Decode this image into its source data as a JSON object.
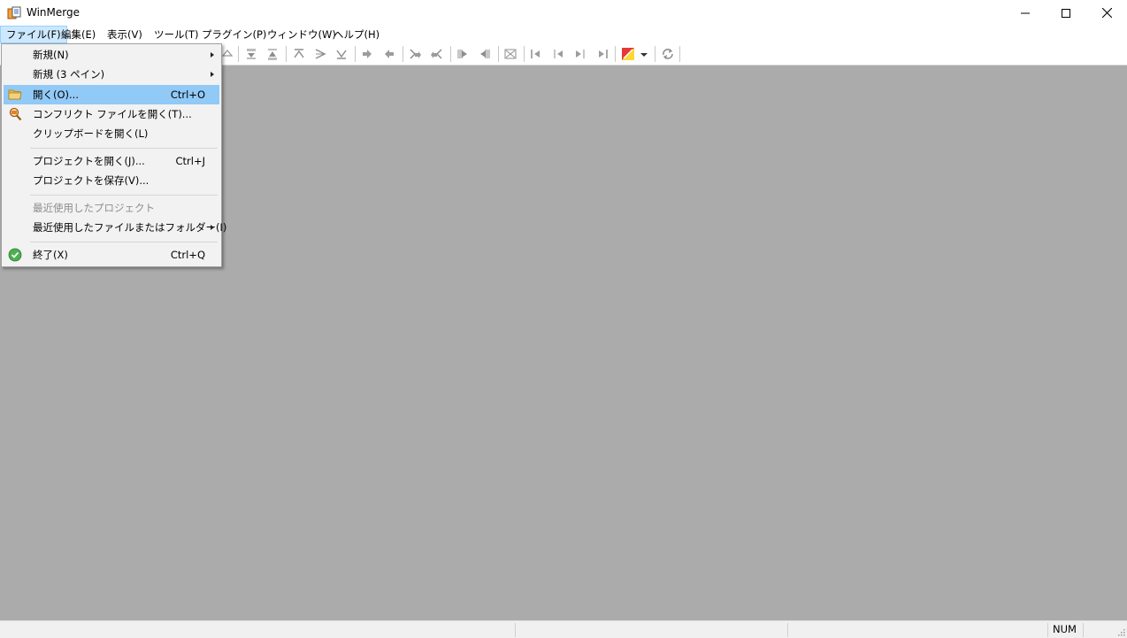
{
  "window": {
    "title": "WinMerge",
    "controls": {
      "minimize": "minimize",
      "maximize": "maximize",
      "close": "close"
    }
  },
  "menubar": {
    "items": [
      {
        "label": "ファイル(F)",
        "active": true
      },
      {
        "label": "編集(E)"
      },
      {
        "label": "表示(V)"
      },
      {
        "label": "ツール(T)"
      },
      {
        "label": "プラグイン(P)"
      },
      {
        "label": "ウィンドウ(W)"
      },
      {
        "label": "ヘルプ(H)"
      }
    ]
  },
  "file_menu": {
    "items": [
      {
        "label": "新規(N)",
        "submenu": true
      },
      {
        "label": "新規 (3 ペイン)",
        "submenu": true
      },
      {
        "label": "開く(O)...",
        "shortcut": "Ctrl+O",
        "icon": "folder-icon",
        "highlighted": true
      },
      {
        "label": "コンフリクト ファイルを開く(T)...",
        "icon": "conflict-search-icon"
      },
      {
        "label": "クリップボードを開く(L)"
      },
      {
        "label": "プロジェクトを開く(J)...",
        "shortcut": "Ctrl+J"
      },
      {
        "label": "プロジェクトを保存(V)..."
      },
      {
        "label": "最近使用したプロジェクト",
        "disabled": true
      },
      {
        "label": "最近使用したファイルまたはフォルダー(I)",
        "submenu": true
      },
      {
        "label": "終了(X)",
        "shortcut": "Ctrl+Q",
        "icon": "exit-check-icon"
      }
    ]
  },
  "statusbar": {
    "num_indicator": "NUM"
  },
  "colors": {
    "workspace": "#ababab",
    "menu_highlight": "#91c9f7",
    "menubar_active": "#cce8ff"
  }
}
